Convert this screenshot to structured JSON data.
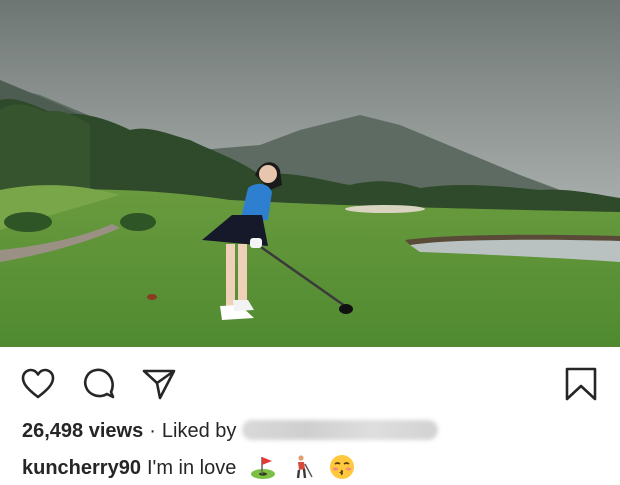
{
  "post": {
    "views_count": "26,498 views",
    "separator": "·",
    "liked_by_label": "Liked by",
    "username": "kuncherry90",
    "caption": "I'm in love",
    "caption_emojis": [
      "flag-in-hole-icon",
      "golfer-icon",
      "kissing-face-icon"
    ]
  },
  "actions": {
    "like": "heart-icon",
    "comment": "comment-bubble-icon",
    "share": "paper-plane-icon",
    "save": "bookmark-icon"
  }
}
